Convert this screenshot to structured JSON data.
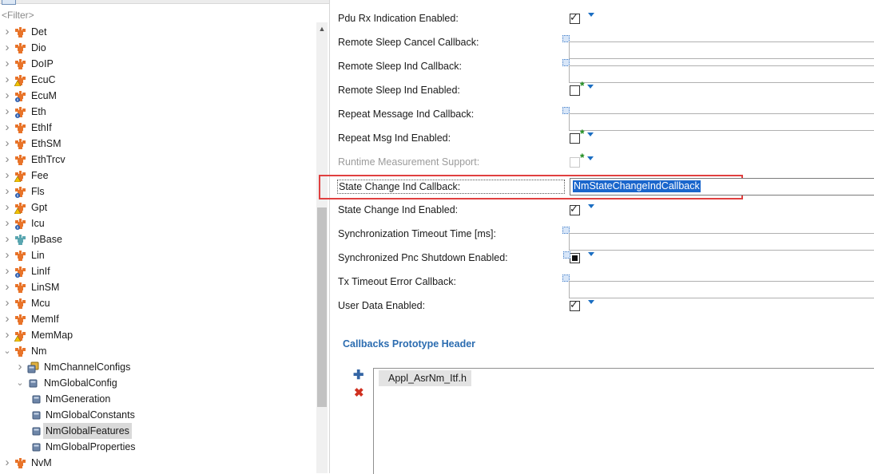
{
  "filter": {
    "placeholder": "<Filter>"
  },
  "tree": [
    {
      "label": "Det",
      "depth": 0,
      "icon": "module-icon",
      "expanded": false
    },
    {
      "label": "Dio",
      "depth": 0,
      "icon": "module-icon",
      "expanded": false
    },
    {
      "label": "DoIP",
      "depth": 0,
      "icon": "module-icon",
      "expanded": false
    },
    {
      "label": "EcuC",
      "depth": 0,
      "icon": "module-warning-icon",
      "expanded": false
    },
    {
      "label": "EcuM",
      "depth": 0,
      "icon": "module-info-icon",
      "expanded": false
    },
    {
      "label": "Eth",
      "depth": 0,
      "icon": "module-info-icon",
      "expanded": false
    },
    {
      "label": "EthIf",
      "depth": 0,
      "icon": "module-icon",
      "expanded": false
    },
    {
      "label": "EthSM",
      "depth": 0,
      "icon": "module-icon",
      "expanded": false
    },
    {
      "label": "EthTrcv",
      "depth": 0,
      "icon": "module-icon",
      "expanded": false
    },
    {
      "label": "Fee",
      "depth": 0,
      "icon": "module-warning-icon",
      "expanded": false
    },
    {
      "label": "Fls",
      "depth": 0,
      "icon": "module-info-icon",
      "expanded": false
    },
    {
      "label": "Gpt",
      "depth": 0,
      "icon": "module-warning-icon",
      "expanded": false
    },
    {
      "label": "Icu",
      "depth": 0,
      "icon": "module-info-icon",
      "expanded": false
    },
    {
      "label": "IpBase",
      "depth": 0,
      "icon": "module-teal-icon",
      "expanded": false
    },
    {
      "label": "Lin",
      "depth": 0,
      "icon": "module-icon",
      "expanded": false
    },
    {
      "label": "LinIf",
      "depth": 0,
      "icon": "module-info-icon",
      "expanded": false
    },
    {
      "label": "LinSM",
      "depth": 0,
      "icon": "module-icon",
      "expanded": false
    },
    {
      "label": "Mcu",
      "depth": 0,
      "icon": "module-icon",
      "expanded": false
    },
    {
      "label": "MemIf",
      "depth": 0,
      "icon": "module-icon",
      "expanded": false
    },
    {
      "label": "MemMap",
      "depth": 0,
      "icon": "module-warning-icon",
      "expanded": false
    },
    {
      "label": "Nm",
      "depth": 0,
      "icon": "module-icon",
      "expanded": true
    },
    {
      "label": "NmChannelConfigs",
      "depth": 1,
      "icon": "container-list-icon",
      "expanded": false
    },
    {
      "label": "NmGlobalConfig",
      "depth": 1,
      "icon": "container-icon",
      "expanded": true
    },
    {
      "label": "NmGeneration",
      "depth": 2,
      "icon": "container-icon",
      "leaf": true
    },
    {
      "label": "NmGlobalConstants",
      "depth": 2,
      "icon": "container-icon",
      "leaf": true
    },
    {
      "label": "NmGlobalFeatures",
      "depth": 2,
      "icon": "container-icon",
      "leaf": true,
      "selected": true
    },
    {
      "label": "NmGlobalProperties",
      "depth": 2,
      "icon": "container-icon",
      "leaf": true
    },
    {
      "label": "NvM",
      "depth": 0,
      "icon": "module-icon",
      "expanded": false
    }
  ],
  "properties": [
    {
      "label": "Pdu Rx Indication Enabled:",
      "type": "checkbox",
      "checked": true,
      "star": false
    },
    {
      "label": "Remote Sleep Cancel Callback:",
      "type": "text",
      "value": ""
    },
    {
      "label": "Remote Sleep Ind Callback:",
      "type": "text",
      "value": ""
    },
    {
      "label": "Remote Sleep Ind Enabled:",
      "type": "checkbox",
      "checked": false,
      "star": true
    },
    {
      "label": "Repeat Message Ind Callback:",
      "type": "text",
      "value": ""
    },
    {
      "label": "Repeat Msg Ind Enabled:",
      "type": "checkbox",
      "checked": false,
      "star": true
    },
    {
      "label": "Runtime Measurement Support:",
      "type": "checkbox",
      "checked": false,
      "star": true,
      "disabled": true
    },
    {
      "label": "State Change Ind Callback:",
      "type": "selected-text",
      "value": "NmStateChangeIndCallback"
    },
    {
      "label": "State Change Ind Enabled:",
      "type": "checkbox",
      "checked": true,
      "star": false
    },
    {
      "label": "Synchronization Timeout Time [ms]:",
      "type": "text",
      "value": ""
    },
    {
      "label": "Synchronized Pnc Shutdown Enabled:",
      "type": "checkbox",
      "indeterminate": true,
      "star": false
    },
    {
      "label": "Tx Timeout Error Callback:",
      "type": "text",
      "value": ""
    },
    {
      "label": "User Data Enabled:",
      "type": "checkbox",
      "checked": true,
      "star": false
    }
  ],
  "callbacks": {
    "title": "Callbacks Prototype Header",
    "items": [
      "Appl_AsrNm_Itf.h"
    ]
  },
  "colors": {
    "module_orange": "#e8742a",
    "accent_blue": "#1b6ec2",
    "highlight_red": "#e04040",
    "selection_blue": "#1a66cc"
  }
}
